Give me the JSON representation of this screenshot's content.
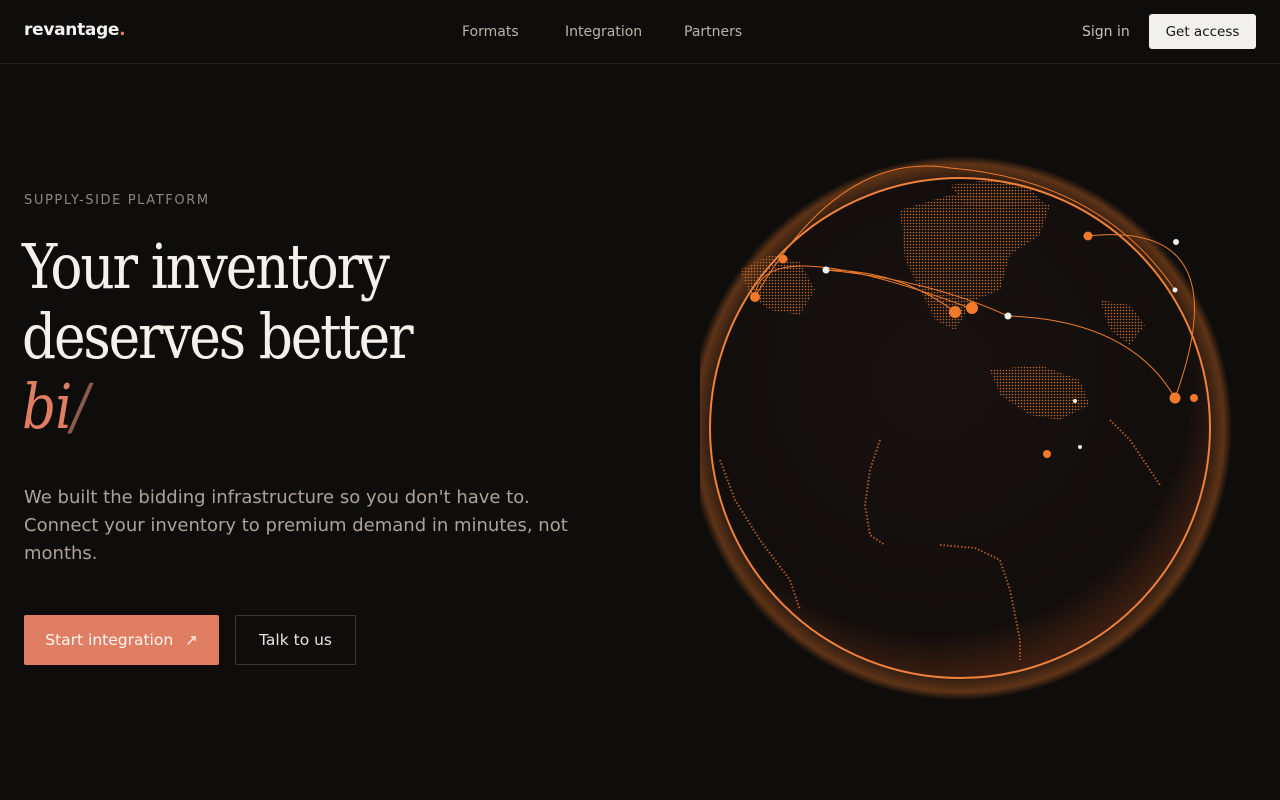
{
  "header": {
    "brand": "revantage",
    "brand_suffix": ".",
    "nav": [
      {
        "label": "Formats"
      },
      {
        "label": "Integration"
      },
      {
        "label": "Partners"
      }
    ],
    "sign_in": "Sign in",
    "cta": "Get access"
  },
  "hero": {
    "eyebrow": "SUPPLY-SIDE PLATFORM",
    "headline_line1": "Your inventory",
    "headline_line2": "deserves better",
    "typed_text": "bi",
    "caret": "/",
    "subtext": "We built the bidding infrastructure so you don't have to. Connect your inventory to premium demand in minutes, not months.",
    "primary_button": "Start integration",
    "primary_arrow": "↗",
    "secondary_button": "Talk to us"
  },
  "colors": {
    "background": "#0f0d0c",
    "accent": "#e07e64",
    "globe_orange": "#f07a2a"
  },
  "icons": {
    "primary_arrow": "arrow-up-right-icon"
  }
}
